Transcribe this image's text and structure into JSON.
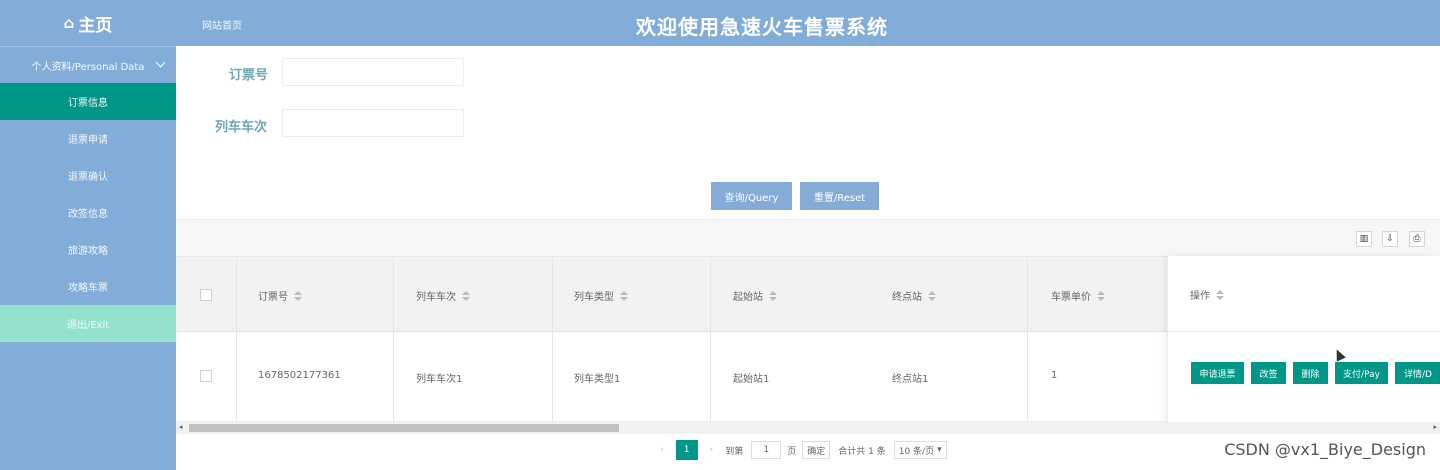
{
  "sidebar": {
    "brand": "主页",
    "group_label": "个人资料/Personal Data",
    "items": [
      {
        "label": "订票信息",
        "active": true
      },
      {
        "label": "退票申请"
      },
      {
        "label": "退票确认"
      },
      {
        "label": "改签信息"
      },
      {
        "label": "旅游攻略"
      },
      {
        "label": "攻略车票"
      },
      {
        "label": "退出/Exit"
      }
    ]
  },
  "header": {
    "breadcrumb": "网站首页",
    "title": "欢迎使用急速火车售票系统"
  },
  "search": {
    "order_label": "订票号",
    "order_value": "",
    "train_label": "列车车次",
    "train_value": "",
    "query_button": "查询/Query",
    "reset_button": "重置/Reset"
  },
  "toolbar": {
    "icons": [
      "columns-icon",
      "export-icon",
      "print-icon"
    ]
  },
  "table": {
    "columns": [
      "订票号",
      "列车车次",
      "列车类型",
      "起始站",
      "终点站",
      "车票单价",
      "操作"
    ],
    "rows": [
      {
        "order_no": "1678502177361",
        "train_no": "列车车次1",
        "train_type": "列车类型1",
        "start": "起始站1",
        "end": "终点站1",
        "price": "1"
      }
    ],
    "actions": [
      "申请退票",
      "改签",
      "删除",
      "支付/Pay",
      "详情/D"
    ]
  },
  "pager": {
    "current_page": "1",
    "goto_label": "到第",
    "goto_value": "1",
    "page_unit": "页",
    "confirm": "确定",
    "total": "合计共 1 条",
    "page_size": "10 条/页"
  },
  "watermark": "CSDN @vx1_Biye_Design",
  "colors": {
    "primary": "#009688",
    "sidebar": "#83add9",
    "exit_item": "#95e1d0",
    "label": "#6fa7b3"
  }
}
